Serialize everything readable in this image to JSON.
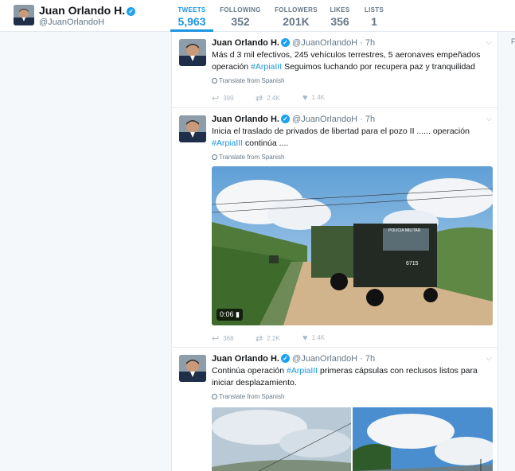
{
  "profile": {
    "name": "Juan Orlando H.",
    "handle": "@JuanOrlandoH"
  },
  "nav": [
    {
      "label": "TWEETS",
      "value": "5,963",
      "active": true
    },
    {
      "label": "FOLLOWING",
      "value": "352"
    },
    {
      "label": "FOLLOWERS",
      "value": "201K"
    },
    {
      "label": "LIKES",
      "value": "356"
    },
    {
      "label": "LISTS",
      "value": "1"
    }
  ],
  "right_edge_text": "F",
  "tweets": [
    {
      "name": "Juan Orlando H.",
      "handle": "@JuanOrlandoH · 7h",
      "text_before": "Más d 3 mil efectivos, 245 vehículos terrestres, 5 aeronaves empeñados operación ",
      "hashtag": "#ArpiaIII",
      "text_after": " Seguimos luchando por recupera paz y tranquilidad",
      "translate": "Translate from Spanish",
      "replies": "399",
      "retweets": "2.4K",
      "likes": "1.4K"
    },
    {
      "name": "Juan Orlando H.",
      "handle": "@JuanOrlandoH · 7h",
      "text_before": "Inicia el traslado de privados de libertad para el pozo II ...... operación ",
      "hashtag": "#ArpiaIII",
      "text_after": " continúa ....",
      "translate": "Translate from Spanish",
      "video_duration": "0:06",
      "truck_text": "POLICIA MILITAR",
      "truck_number": "6715",
      "replies": "368",
      "retweets": "2.2K",
      "likes": "1.4K"
    },
    {
      "name": "Juan Orlando H.",
      "handle": "@JuanOrlandoH · 7h",
      "text_before": "Continúa operación ",
      "hashtag": "#ArpiaIII",
      "text_after": " primeras cápsulas con reclusos listos para iniciar desplazamiento.",
      "translate": "Translate from Spanish"
    }
  ],
  "icons": {
    "verified": "verified-badge-icon",
    "caret": "chevron-down-icon",
    "reply": "reply-icon",
    "retweet": "retweet-icon",
    "like": "heart-icon",
    "globe": "globe-icon"
  },
  "colors": {
    "accent": "#1b95e0",
    "verified": "#1da1f2"
  }
}
